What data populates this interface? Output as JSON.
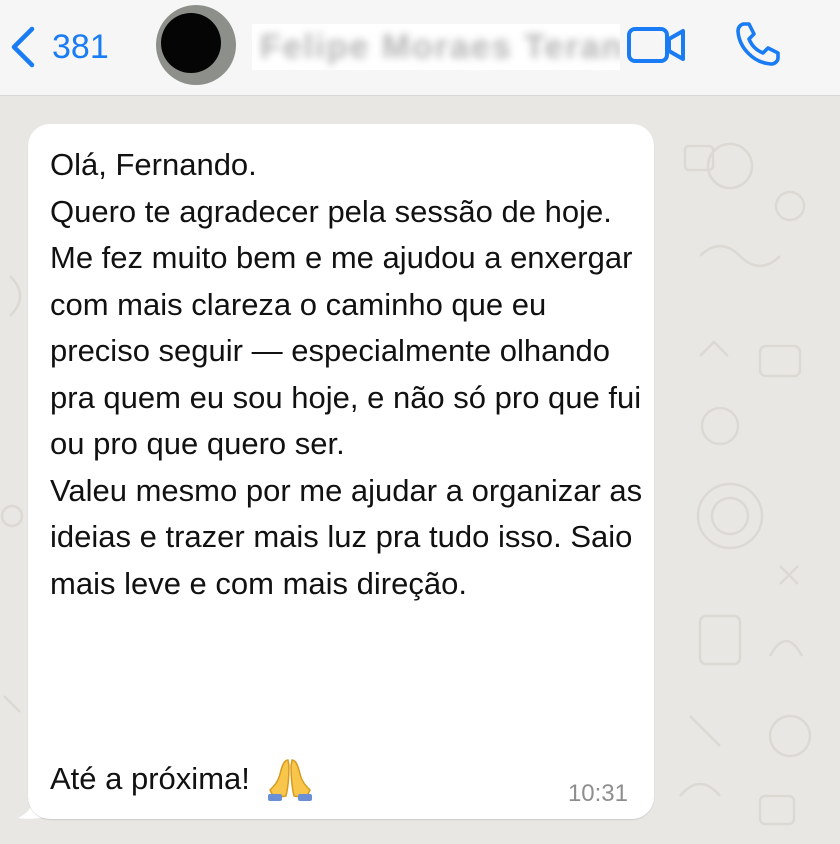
{
  "header": {
    "back_count": "381",
    "contact_name": "Felipe Moraes Teran",
    "icons": {
      "back": "chevron-left-icon",
      "video": "video-camera-icon",
      "call": "phone-icon"
    },
    "accent": "#1a7cf5"
  },
  "message": {
    "text": "Olá, Fernando.\nQuero te agradecer pela sessão de hoje. Me fez muito bem e me ajudou a enxergar com mais clareza o caminho que eu preciso seguir — especialmente olhando pra quem eu sou hoje, e não só pro que fui ou pro que quero ser.\nValeu mesmo por me ajudar a organizar as ideias e trazer mais luz pra tudo isso. Saio mais leve e com mais direção.",
    "closing": "Até a próxima!",
    "emoji": "folded-hands-icon",
    "time": "10:31"
  }
}
